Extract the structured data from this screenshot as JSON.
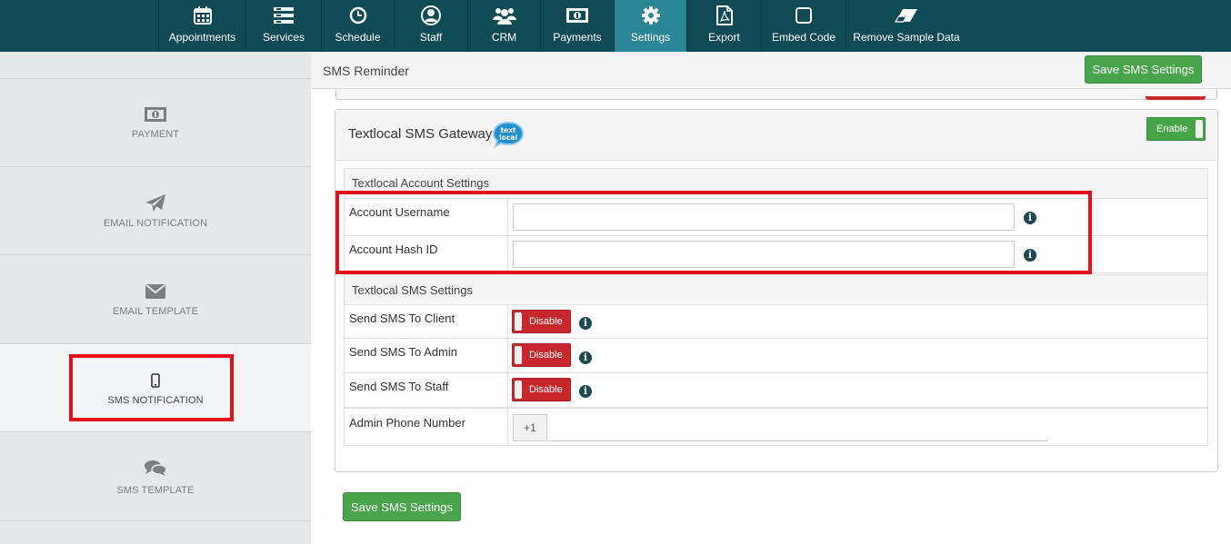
{
  "nav": {
    "items": [
      {
        "label": "Appointments",
        "icon": "calendar-icon"
      },
      {
        "label": "Services",
        "icon": "list-icon"
      },
      {
        "label": "Schedule",
        "icon": "clock-icon"
      },
      {
        "label": "Staff",
        "icon": "user-icon"
      },
      {
        "label": "CRM",
        "icon": "users-icon"
      },
      {
        "label": "Payments",
        "icon": "money-icon"
      },
      {
        "label": "Settings",
        "icon": "gear-icon"
      },
      {
        "label": "Export",
        "icon": "pdf-icon"
      },
      {
        "label": "Embed Code",
        "icon": "square-icon"
      },
      {
        "label": "Remove Sample Data",
        "icon": "eraser-icon"
      }
    ],
    "active": "Settings",
    "colors": {
      "bar": "#0f4a55",
      "active": "#2a8697"
    }
  },
  "sidebar": {
    "items": [
      {
        "label": "PAYMENT",
        "icon": "money-icon"
      },
      {
        "label": "EMAIL NOTIFICATION",
        "icon": "paper-plane-icon"
      },
      {
        "label": "EMAIL TEMPLATE",
        "icon": "envelope-icon"
      },
      {
        "label": "SMS NOTIFICATION",
        "icon": "mobile-icon"
      },
      {
        "label": "SMS TEMPLATE",
        "icon": "comments-icon"
      }
    ],
    "active": "SMS NOTIFICATION"
  },
  "header": {
    "title": "SMS Reminder",
    "save_label": "Save SMS Settings"
  },
  "gateway": {
    "title": "Textlocal SMS Gateway",
    "logo_text_1": "text",
    "logo_text_2": "local",
    "toggle_label": "Enable",
    "account_section": "Textlocal Account Settings",
    "username_label": "Account Username",
    "username_value": "",
    "hash_label": "Account Hash ID",
    "hash_value": "",
    "sms_section": "Textlocal SMS Settings",
    "client_label": "Send SMS To Client",
    "client_toggle": "Disable",
    "admin_label": "Send SMS To Admin",
    "admin_toggle": "Disable",
    "staff_label": "Send SMS To Staff",
    "staff_toggle": "Disable",
    "phone_label": "Admin Phone Number",
    "phone_prefix": "+1",
    "phone_value": "",
    "info_glyph": "i"
  },
  "footer": {
    "save_label": "Save SMS Settings"
  },
  "colors": {
    "green": "#48a54c",
    "red": "#c8282c",
    "highlight": "#e5101a"
  }
}
